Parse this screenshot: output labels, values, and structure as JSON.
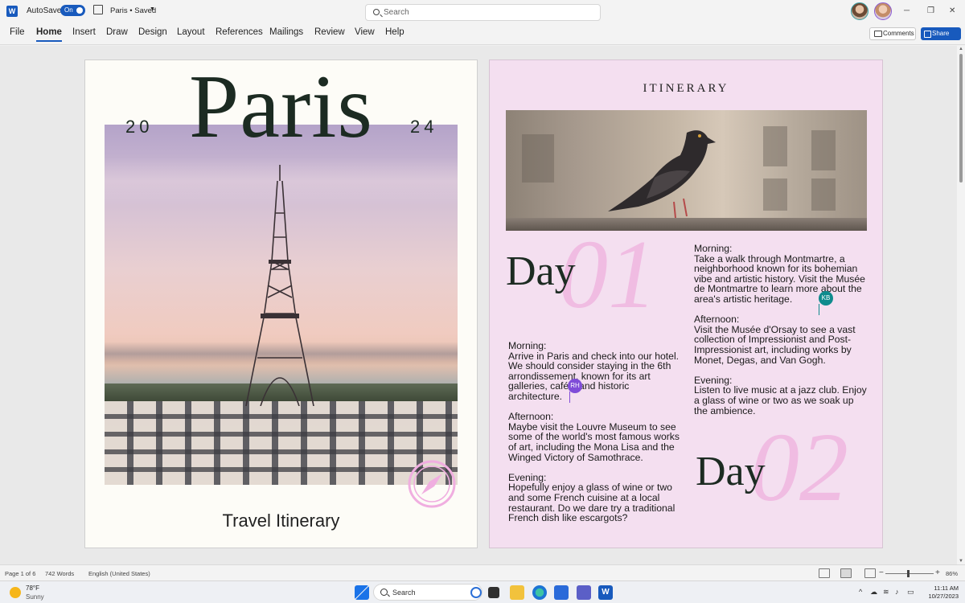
{
  "app": {
    "autosave_label": "AutoSave",
    "autosave_state": "On",
    "doc_title": "Paris • Saved",
    "search_placeholder": "Search",
    "accent_color": "#185abd"
  },
  "ribbon": {
    "tabs": [
      "File",
      "Home",
      "Insert",
      "Draw",
      "Design",
      "Layout",
      "References",
      "Mailings",
      "Review",
      "View",
      "Help"
    ],
    "active_tab": "Home",
    "comments_label": "Comments",
    "share_label": "Share"
  },
  "page1": {
    "title": "Paris",
    "year_left": "20",
    "year_right": "24",
    "subtitle": "Travel Itinerary"
  },
  "page2": {
    "heading": "ITINERARY",
    "day1": {
      "word": "Day",
      "number": "01",
      "morning_label": "Morning:",
      "morning_text": "Arrive in Paris and check into our hotel. We should consider staying in the 6th arrondissement, known for its art galleries, cafés, and historic architecture.",
      "afternoon_label": "Afternoon:",
      "afternoon_text": "Maybe visit the Louvre Museum to see some of the world's most famous works of art, including the Mona Lisa and the Winged Victory of Samothrace.",
      "evening_label": "Evening:",
      "evening_text": "Hopefully enjoy a glass of wine or two and some French cuisine at a local restaurant. Do we dare try a traditional French dish like escargots?"
    },
    "day2": {
      "word": "Day",
      "number": "02",
      "morning_label": "Morning:",
      "morning_text": "Take a walk through Montmartre, a neighborhood known for its bohemian vibe and artistic history. Visit the Musée de Montmartre to learn more about the area's artistic heritage.",
      "afternoon_label": "Afternoon:",
      "afternoon_text": "Visit the Musée d'Orsay to see a vast collection of Impressionist and Post-Impressionist art, including works by Monet, Degas, and Van Gogh.",
      "evening_label": "Evening:",
      "evening_text": "Listen to live music at a jazz club. Enjoy a glass of wine or two as we soak up the ambience."
    },
    "collaborators": [
      {
        "initials": "RH",
        "color": "#7f4cd8"
      },
      {
        "initials": "KB",
        "color": "#0f8b8d"
      }
    ]
  },
  "status": {
    "page": "Page 1 of 6",
    "words": "742 Words",
    "language": "English (United States)",
    "zoom": "86%"
  },
  "taskbar": {
    "temperature": "78°F",
    "condition": "Sunny",
    "search_placeholder": "Search",
    "time": "11:11 AM",
    "date": "10/27/2023"
  }
}
